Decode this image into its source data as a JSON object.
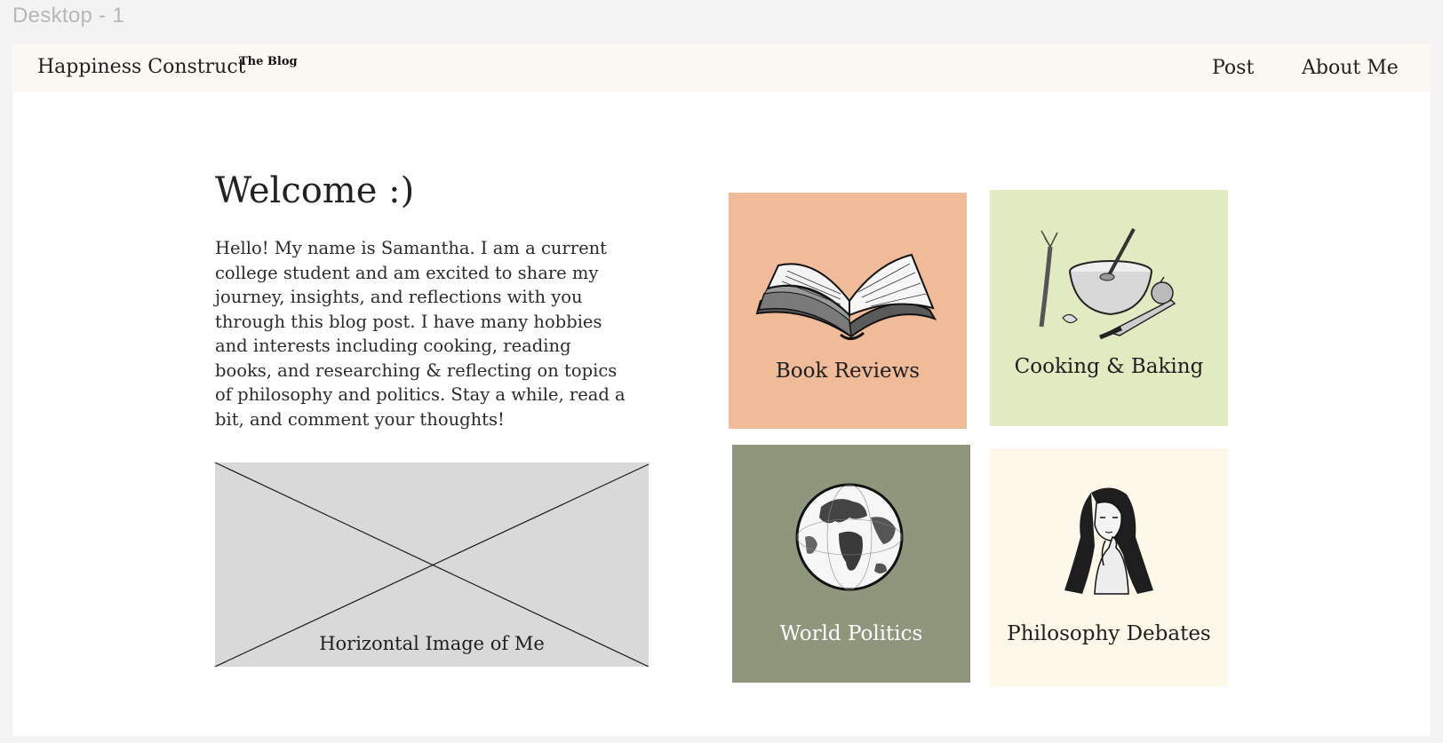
{
  "canvas": {
    "frame_label": "Desktop - 1"
  },
  "navbar": {
    "brand": "Happiness Construct",
    "brand_tag": "The Blog",
    "links": [
      {
        "label": "Post"
      },
      {
        "label": "About Me"
      }
    ],
    "background": "#fbf9f1"
  },
  "hero": {
    "title": "Welcome :)",
    "intro": "Hello! My name is Samantha. I am a current college student and am excited to share my journey, insights, and reflections with you through this blog post. I have many hobbies and interests including cooking, reading books, and  researching & reflecting on topics of philosophy and politics. Stay a while, read a bit, and comment your thoughts!",
    "image_placeholder_caption": "Horizontal Image of Me"
  },
  "categories": [
    {
      "label": "Book Reviews",
      "icon": "open-book-icon",
      "background": "#efbb98",
      "text_color": "#1f1f1f"
    },
    {
      "label": "Cooking & Baking",
      "icon": "mixing-bowl-icon",
      "background": "#e1eac1",
      "text_color": "#1f1f1f"
    },
    {
      "label": "World Politics",
      "icon": "globe-icon",
      "background": "#8e977b",
      "text_color": "#ffffff"
    },
    {
      "label": "Philosophy Debates",
      "icon": "thinking-woman-icon",
      "background": "#fdf8e9",
      "text_color": "#1f1f1f"
    }
  ]
}
